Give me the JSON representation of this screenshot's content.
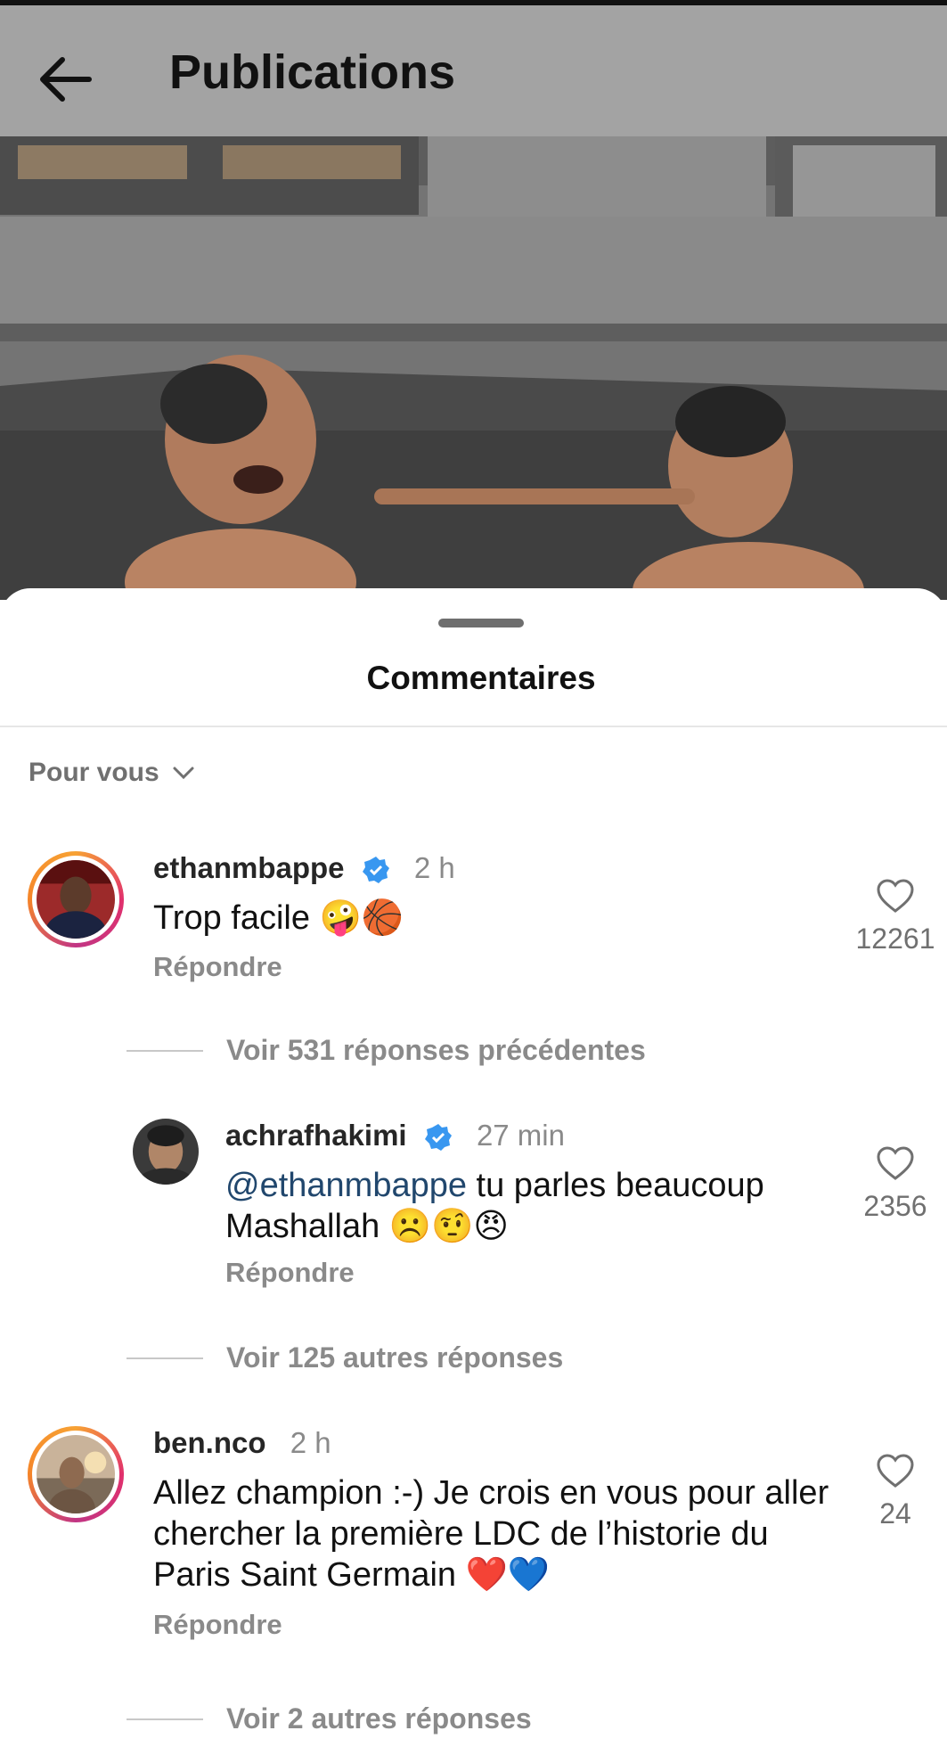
{
  "header": {
    "title": "Publications",
    "back_icon": "arrow-left-icon"
  },
  "sheet": {
    "title": "Commentaires",
    "filter_label": "Pour vous"
  },
  "comments": [
    {
      "username": "ethanmbappe",
      "verified": true,
      "time": "2 h",
      "text": "Trop facile 🤪🏀",
      "reply_label": "Répondre",
      "likes": "12261",
      "view_more": "Voir 531 réponses précédentes"
    },
    {
      "username": "achrafhakimi",
      "verified": true,
      "time": "27 min",
      "mention": "@ethanmbappe",
      "text": " tu parles beaucoup Mashallah ☹️🤨😠",
      "reply_label": "Répondre",
      "likes": "2356",
      "view_more": "Voir 125 autres réponses"
    },
    {
      "username": "ben.nco",
      "verified": false,
      "time": "2 h",
      "text": "Allez champion :-) Je crois en vous pour aller chercher la première LDC de l’historie du Paris Saint Germain ❤️💙",
      "reply_label": "Répondre",
      "likes": "24",
      "view_more": "Voir 2 autres réponses"
    }
  ],
  "colors": {
    "accent_verified": "#3897f0",
    "mention": "#21476d",
    "muted": "#8a8a8a"
  }
}
